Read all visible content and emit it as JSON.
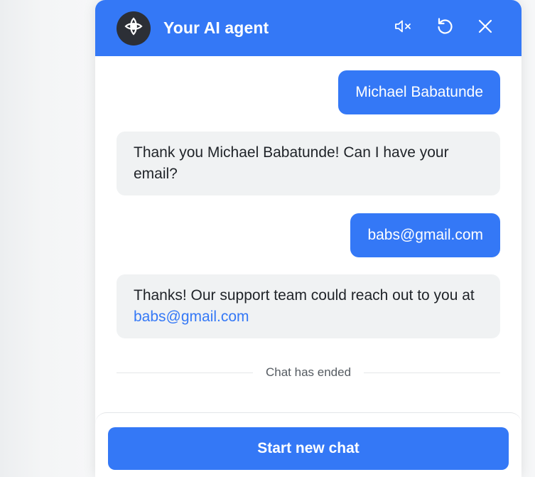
{
  "header": {
    "title": "Your AI agent",
    "icons": [
      "logo-icon",
      "mute-icon",
      "restart-icon",
      "close-icon"
    ]
  },
  "messages": [
    {
      "role": "user",
      "text": "Michael Babatunde"
    },
    {
      "role": "agent",
      "text": "Thank you Michael Babatunde! Can I have your email?"
    },
    {
      "role": "user",
      "text": "babs@gmail.com"
    },
    {
      "role": "agent",
      "text_prefix": "Thanks! Our support team could reach out to you at ",
      "link": "babs@gmail.com"
    }
  ],
  "status": {
    "ended_label": "Chat has ended"
  },
  "footer": {
    "start_new_chat_label": "Start new chat"
  },
  "colors": {
    "accent": "#3478f6",
    "bot_bubble": "#f0f2f3",
    "avatar_bg": "#2c2f36"
  }
}
